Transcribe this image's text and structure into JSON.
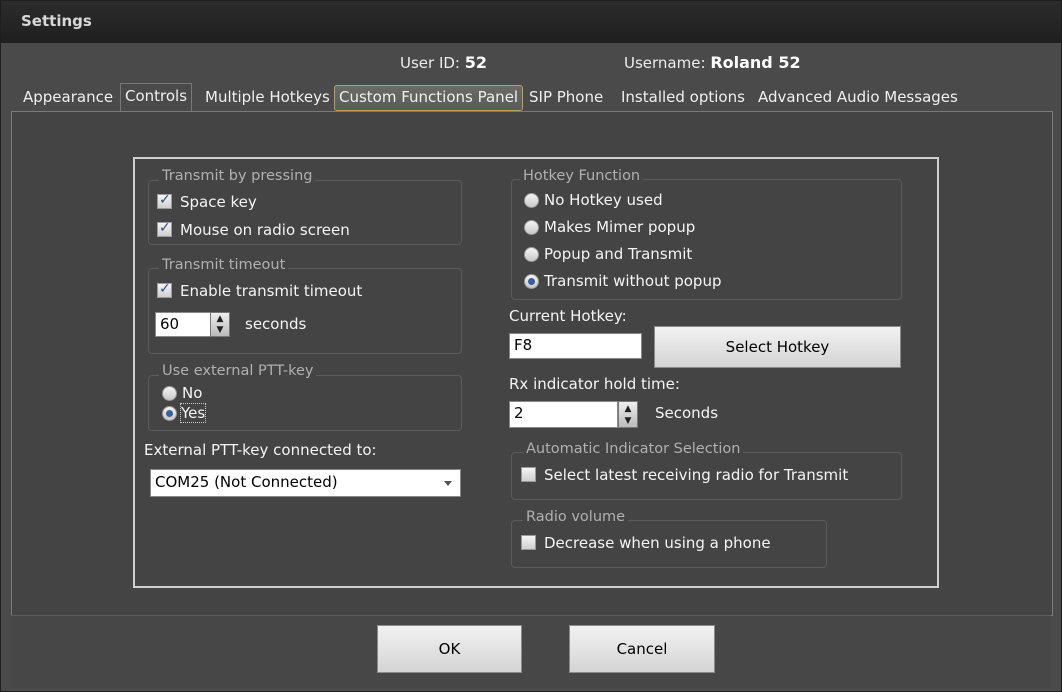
{
  "window": {
    "title": "Settings"
  },
  "user": {
    "id_label": "User ID:",
    "id_value": "52",
    "name_label": "Username:",
    "name_value": "Roland 52"
  },
  "tabs": [
    {
      "label": "Appearance"
    },
    {
      "label": "Controls"
    },
    {
      "label": "Multiple Hotkeys"
    },
    {
      "label": "Custom Functions Panel"
    },
    {
      "label": "SIP Phone"
    },
    {
      "label": "Installed options"
    },
    {
      "label": "Advanced Audio Messages"
    }
  ],
  "transmit_by_pressing": {
    "title": "Transmit by pressing",
    "space_key": {
      "label": "Space key",
      "checked": true
    },
    "mouse_on_radio": {
      "label": "Mouse on radio screen",
      "checked": true
    }
  },
  "transmit_timeout": {
    "title": "Transmit timeout",
    "enable": {
      "label": "Enable transmit timeout",
      "checked": true
    },
    "value": "60",
    "unit": "seconds"
  },
  "external_ptt": {
    "title": "Use external PTT-key",
    "no_label": "No",
    "yes_label": "Yes",
    "selected": "Yes",
    "connected_label": "External PTT-key connected to:",
    "port_value": "COM25 (Not Connected)"
  },
  "hotkey_function": {
    "title": "Hotkey Function",
    "options": [
      "No Hotkey used",
      "Makes Mimer popup",
      "Popup and Transmit",
      "Transmit without popup"
    ],
    "selected": "Transmit without popup"
  },
  "current_hotkey": {
    "label": "Current Hotkey:",
    "value": "F8",
    "button": "Select Hotkey"
  },
  "rx_indicator": {
    "label": "Rx indicator hold time:",
    "value": "2",
    "unit": "Seconds"
  },
  "auto_indicator": {
    "title": "Automatic Indicator Selection",
    "label": "Select latest receiving radio for Transmit",
    "checked": false
  },
  "radio_volume": {
    "title": "Radio volume",
    "label": "Decrease when using a phone",
    "checked": false
  },
  "footer": {
    "ok": "OK",
    "cancel": "Cancel"
  }
}
